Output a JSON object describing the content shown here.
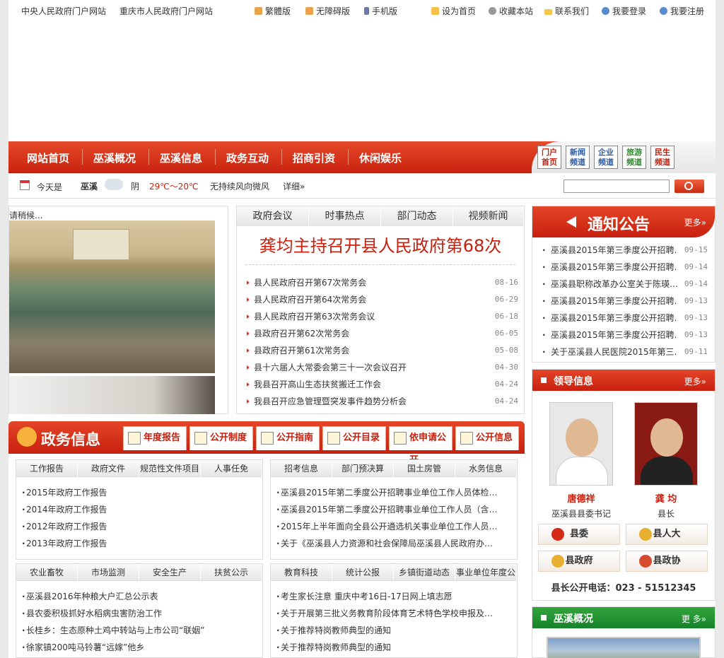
{
  "top_links_left": [
    "中央人民政府门户网站",
    "重庆市人民政府门户网站"
  ],
  "top_links_mid": [
    {
      "label": "繁體版",
      "icon": "traditional-icon"
    },
    {
      "label": "无障碍版",
      "icon": "accessibility-icon"
    },
    {
      "label": "手机版",
      "icon": "mobile-icon"
    }
  ],
  "top_links_right": [
    {
      "label": "设为首页",
      "icon": "home-icon"
    },
    {
      "label": "收藏本站",
      "icon": "bookmark-icon"
    },
    {
      "label": "联系我们",
      "icon": "mail-icon"
    },
    {
      "label": "我要登录",
      "icon": "login-icon"
    },
    {
      "label": "我要注册",
      "icon": "register-icon"
    }
  ],
  "nav": [
    "网站首页",
    "巫溪概况",
    "巫溪信息",
    "政务互动",
    "招商引资",
    "休闲娱乐"
  ],
  "channels": [
    "门户\n首页",
    "新闻\n频道",
    "企业\n频道",
    "旅游\n频道",
    "民生\n频道"
  ],
  "weather": {
    "today_label": "今天是",
    "city": "巫溪",
    "condition": "阴",
    "temp": "29℃～20℃",
    "wind": "无持续风向微风",
    "detail": "详细»"
  },
  "photo": {
    "caption": "请稍候..."
  },
  "news": {
    "tabs": [
      "政府会议",
      "时事热点",
      "部门动态",
      "视频新闻"
    ],
    "headline": "龚均主持召开县人民政府第68次",
    "items": [
      {
        "title": "县人民政府召开第67次常务会",
        "date": "08-16"
      },
      {
        "title": "县人民政府召开第64次常务会",
        "date": "06-29"
      },
      {
        "title": "县人民政府召开第63次常务会议",
        "date": "06-18"
      },
      {
        "title": "县政府召开第62次常务会",
        "date": "06-05"
      },
      {
        "title": "县政府召开第61次常务会",
        "date": "05-08"
      },
      {
        "title": "县十六届人大常委会第三十一次会议召开",
        "date": "04-30"
      },
      {
        "title": "我县召开高山生态扶贫搬迁工作会",
        "date": "04-24"
      },
      {
        "title": "我县召开应急管理暨突发事件趋势分析会",
        "date": "04-24"
      }
    ]
  },
  "notice": {
    "title": "通知公告",
    "more": "更多»",
    "items": [
      {
        "title": "巫溪县2015年第三季度公开招聘…",
        "date": "09-15"
      },
      {
        "title": "巫溪县2015年第三季度公开招聘…",
        "date": "09-14"
      },
      {
        "title": "巫溪县职称改革办公室关于陈瑛…",
        "date": "09-14"
      },
      {
        "title": "巫溪县2015年第三季度公开招聘…",
        "date": "09-13"
      },
      {
        "title": "巫溪县2015年第三季度公开招聘…",
        "date": "09-13"
      },
      {
        "title": "巫溪县2015年第三季度公开招聘…",
        "date": "09-13"
      },
      {
        "title": "关于巫溪县人民医院2015年第三…",
        "date": "09-11"
      }
    ]
  },
  "leaders": {
    "title": "领导信息",
    "more": "更多»",
    "people": [
      {
        "name": "唐德祥",
        "role": "巫溪县县委书记"
      },
      {
        "name": "龚  均",
        "role": "县长"
      }
    ],
    "orgs": [
      "县委",
      "县人大",
      "县政府",
      "县政协"
    ],
    "phone": "县长公开电话：023 - 51512345"
  },
  "overview": {
    "title": "巫溪概况",
    "more": "更 多»"
  },
  "gov": {
    "title": "政务信息",
    "tabs": [
      "年度报告",
      "公开制度",
      "公开指南",
      "公开目录",
      "依申请公开",
      "公开信息"
    ]
  },
  "boxes": [
    {
      "tabs": [
        "工作报告",
        "政府文件",
        "规范性文件项目",
        "人事任免"
      ],
      "items": [
        "2015年政府工作报告",
        "2014年政府工作报告",
        "2012年政府工作报告",
        "2013年政府工作报告"
      ]
    },
    {
      "tabs": [
        "招考信息",
        "部门预决算",
        "国土房管",
        "水务信息"
      ],
      "items": [
        "巫溪县2015年第二季度公开招聘事业单位工作人员体检…",
        "巫溪县2015年第二季度公开招聘事业单位工作人员（含…",
        "2015年上半年面向全县公开遴选机关事业单位工作人员…",
        "关于《巫溪县人力资源和社会保障局巫溪县人民政府办…"
      ]
    },
    {
      "tabs": [
        "农业畜牧",
        "市场监测",
        "安全生产",
        "扶贫公示"
      ],
      "items": [
        "巫溪县2016年种粮大户汇总公示表",
        "县农委积极抓好水稻病虫害防治工作",
        "长桂乡：生态原种土鸡中转站与上市公司“联姻”",
        "徐家镇200吨马铃薯“远嫁”他乡"
      ]
    },
    {
      "tabs": [
        "教育科技",
        "统计公报",
        "乡镇街道动态",
        "事业单位年度公"
      ],
      "items": [
        "考生家长注意 重庆中考16日-17日网上填志愿",
        "关于开展第三批义务教育阶段体育艺术特色学校申报及…",
        "关于推荐特岗教师典型的通知",
        "关于推荐特岗教师典型的通知"
      ]
    }
  ]
}
